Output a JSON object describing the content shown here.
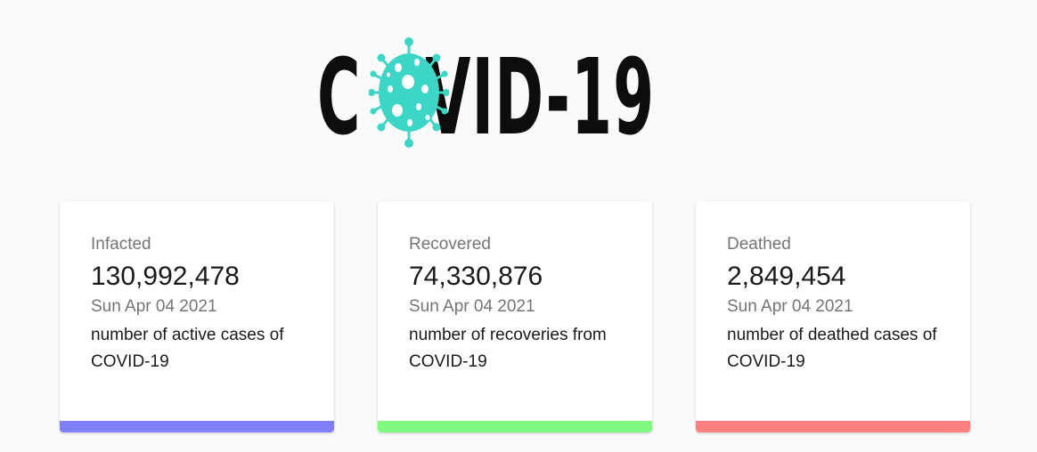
{
  "logo": {
    "text_first": "C",
    "text_rest": "VID-19",
    "virus_icon": "virus-icon",
    "virus_color": "#3dd6c6"
  },
  "cards": [
    {
      "label": "Infacted",
      "value": "130,992,478",
      "date": "Sun Apr 04 2021",
      "description": "number of active cases of COVID-19",
      "accent": "#8080ff"
    },
    {
      "label": "Recovered",
      "value": "74,330,876",
      "date": "Sun Apr 04 2021",
      "description": "number of recoveries from COVID-19",
      "accent": "#80f980"
    },
    {
      "label": "Deathed",
      "value": "2,849,454",
      "date": "Sun Apr 04 2021",
      "description": "number of deathed cases of COVID-19",
      "accent": "#ff8080"
    }
  ]
}
